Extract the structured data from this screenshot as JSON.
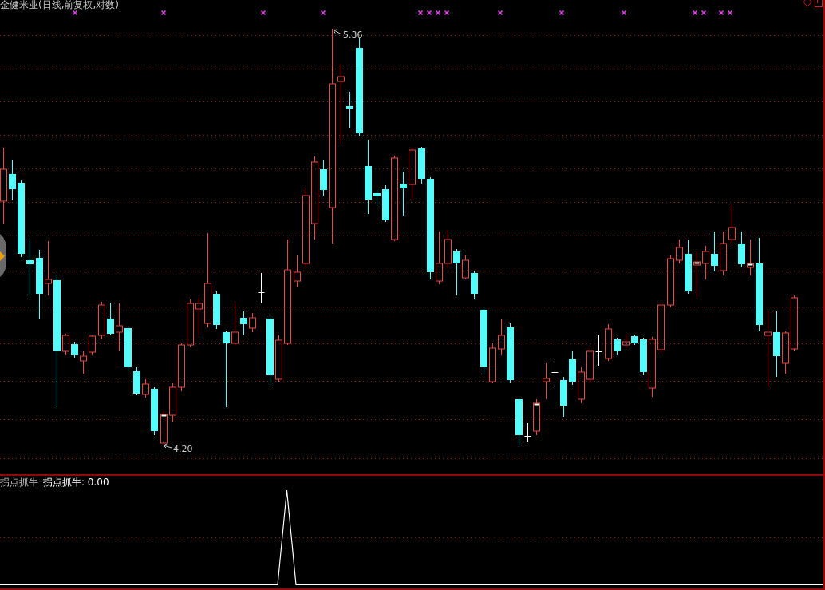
{
  "chart_title": "金健米业(日线,前复权,对数)",
  "price_chart": {
    "high_label": "5.36",
    "low_label": "4.20"
  },
  "indicator": {
    "name": "拐点抓牛",
    "reading": "拐点抓牛: 0.00"
  }
}
